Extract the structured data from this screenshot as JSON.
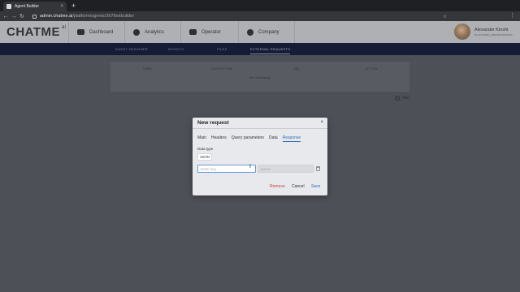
{
  "browser": {
    "tab_title": "Agent Builder",
    "tab_close": "×",
    "new_tab": "+",
    "url_host": "admin.chatme.ai",
    "url_path": "/platform/agents/397/botbuilder",
    "back": "←",
    "forward": "→",
    "reload": "↻",
    "star": "☆",
    "menu": "⋮"
  },
  "header": {
    "logo": "CHATME",
    "logo_suffix": "ai",
    "nav": [
      {
        "label": "Dashboard",
        "icon": "toggle-icon"
      },
      {
        "label": "Analytics",
        "icon": "pie-chart-icon"
      },
      {
        "label": "Operator",
        "icon": "chat-icon"
      },
      {
        "label": "Company",
        "icon": "person-icon"
      }
    ],
    "user": {
      "name": "Alexander Kinsht",
      "role": "PLATFORM_ADMINISTRATOR"
    }
  },
  "subnav": {
    "tabs": [
      "AGENT DESIGNER",
      "INTENTS",
      "FILES",
      "EXTERNAL REQUESTS"
    ],
    "active": "EXTERNAL REQUESTS"
  },
  "content": {
    "columns": [
      "NAME",
      "DESCRIPTION",
      "URL",
      "ACTION"
    ],
    "empty_text": "No rows found",
    "add_label": "Add",
    "add_icon": "+"
  },
  "modal": {
    "title": "New request",
    "close": "×",
    "tabs": [
      "Main",
      "Headers",
      "Query parameters",
      "Data",
      "Response"
    ],
    "active_tab": "Response",
    "data_type_label": "Data type",
    "data_type_value": "JSON",
    "key_placeholder": "Enter key",
    "name_placeholder": "Name",
    "cursor": "I",
    "remove_label": "Remove",
    "cancel_label": "Cancel",
    "save_label": "Save"
  }
}
